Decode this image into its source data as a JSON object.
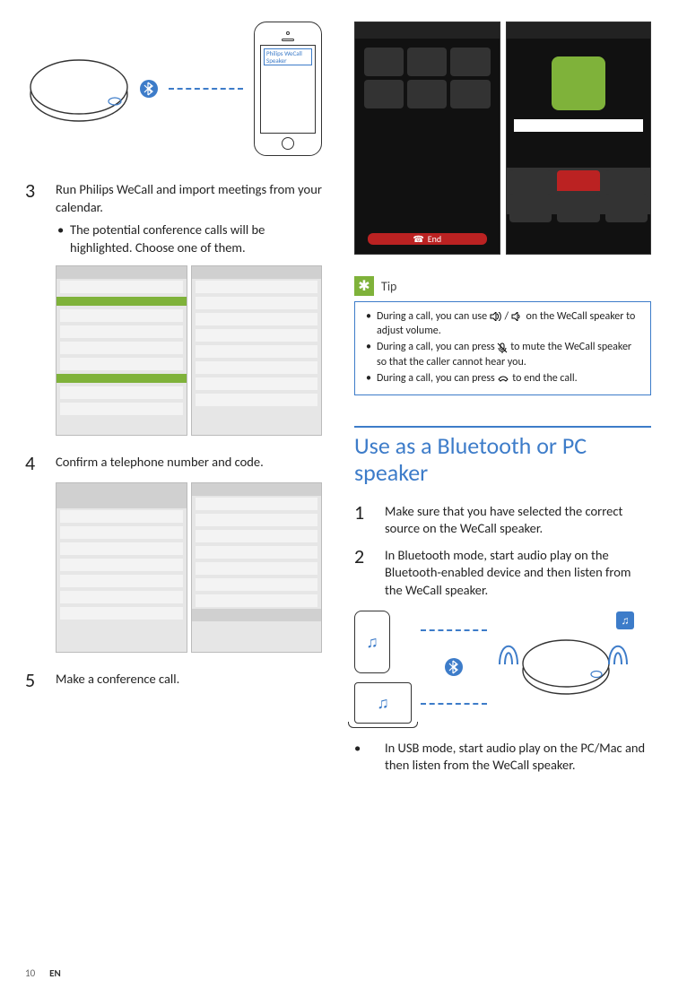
{
  "pairing": {
    "phone_label": "Philips WeCall Speaker"
  },
  "left": {
    "step3": {
      "num": "3",
      "text": "Run Philips WeCall and import meetings from your calendar.",
      "bullet": "The potential conference calls will be highlighted. Choose one of them."
    },
    "step4": {
      "num": "4",
      "text": "Confirm a telephone number and code."
    },
    "step5": {
      "num": "5",
      "text": "Make a conference call."
    }
  },
  "right": {
    "end_button": "End",
    "tip_label": "Tip",
    "tips": {
      "t1a": "During a call, you can use ",
      "t1b": " / ",
      "t1c": " on the WeCall speaker to adjust volume.",
      "t2a": "During a call, you can press ",
      "t2b": " to mute the WeCall speaker so that the caller cannot hear you.",
      "t3a": "During a call, you can press ",
      "t3b": " to end the call."
    },
    "section_title": "Use as a Bluetooth or PC speaker",
    "step1": {
      "num": "1",
      "text": "Make sure that you have selected the correct source on the WeCall speaker."
    },
    "step2": {
      "num": "2",
      "text": "In Bluetooth mode, start audio play on the Bluetooth-enabled device and then listen from the WeCall speaker."
    },
    "usb_bullet": "In USB mode, start audio play on the PC/Mac and then listen from the WeCall speaker."
  },
  "footer": {
    "page": "10",
    "lang": "EN"
  }
}
